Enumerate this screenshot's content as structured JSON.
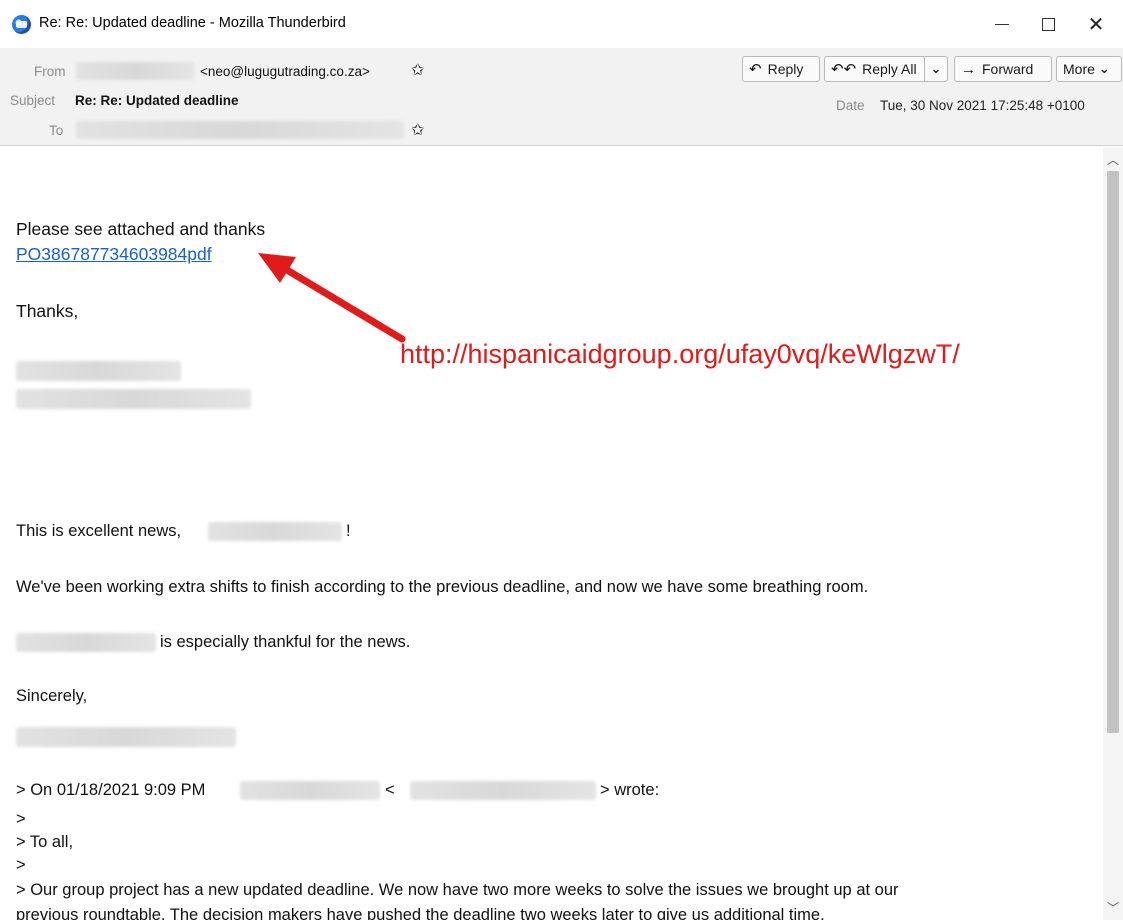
{
  "window": {
    "title": "Re: Re: Updated deadline - Mozilla Thunderbird",
    "minimize": "—",
    "close": "✕"
  },
  "header": {
    "from_label": "From",
    "from_email": "<neo@lugugutrading.co.za>",
    "subject_label": "Subject",
    "subject": "Re: Re: Updated deadline",
    "to_label": "To",
    "date_label": "Date",
    "date": "Tue, 30 Nov 2021 17:25:48 +0100",
    "star": "✩"
  },
  "toolbar": {
    "reply_label": "Reply",
    "reply_all_label": "Reply All",
    "forward_label": "Forward",
    "more_label": "More",
    "reply_icon": "reply-icon",
    "reply_all_icon": "reply-all-icon",
    "forward_icon": "forward-arrow-icon",
    "dropdown_icon": "chevron-down-icon"
  },
  "message": {
    "line1": "Please see attached and thanks",
    "attachment_link": "PO386787734603984pdf",
    "thanks": "Thanks,",
    "excellent_pre": "This is excellent news,",
    "excellent_post": "!",
    "working": "We've been working extra shifts to finish according to the previous deadline, and now we have some breathing room.",
    "thankful": "is especially thankful for the news.",
    "sincerely": "Sincerely,",
    "quote_on": "> On 01/18/2021 9:09 PM",
    "quote_lt": "<",
    "quote_wrote": "> wrote:",
    "quote_gt1": ">",
    "quote_toall": "> To all,",
    "quote_gt2": ">",
    "quote_group": "> Our group project has a new updated deadline. We now have two more weeks to solve the issues we brought up at our",
    "quote_prev": "previous roundtable. The decision makers have pushed the deadline two weeks later to give us additional time."
  },
  "annotation": {
    "url": "http://hispanicaidgroup.org/ufay0vq/keWlgzwT/",
    "color": "#e11a1a"
  },
  "colors": {
    "link": "#1a5fd0",
    "header_bg": "#f2f2f2"
  }
}
